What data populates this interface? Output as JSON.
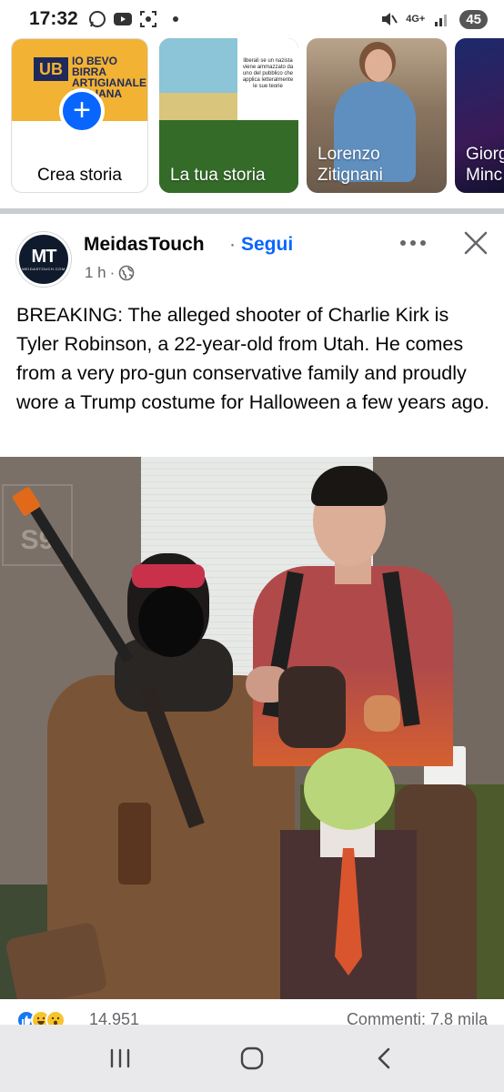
{
  "status_bar": {
    "time": "17:32",
    "network": "4G+",
    "battery": "45"
  },
  "stories": {
    "create_label": "Crea storia",
    "create_logo_main": "UB",
    "create_logo_text": "IO BEVO BIRRA ARTIGIANALE ITALIANA",
    "mine_label": "La tua storia",
    "mine_note_text": "liberali se un nazista viene ammazzato da uno del pubblico che applica letteralmente le sue teorie",
    "lorenzo_label": "Lorenzo Zitignani",
    "giorg_label": "Giorg Minc"
  },
  "post": {
    "author": "MeidasTouch",
    "follow_separator": "·",
    "follow_label": "Segui",
    "time": "1 h",
    "meta_separator": "·",
    "avatar_text": "MT",
    "avatar_subtext": "MEIDASTOUCH.COM",
    "text": "BREAKING: The alleged shooter of Charlie Kirk is Tyler Robinson, a 22-year-old from Utah. He comes from a very pro-gun conservative family and proudly wore a Trump costume for Halloween a few years ago.",
    "photo_number": "S9",
    "reaction_count": "14.951",
    "comments": "Commenti: 7,8 mila"
  },
  "colors": {
    "accent": "#0866ff",
    "secondary_text": "#65676b",
    "divider": "#c9ccd1"
  },
  "icons": {
    "more": "more-horizontal-icon",
    "close": "close-icon",
    "globe": "globe-icon",
    "nav_recent": "recent-apps-icon",
    "nav_home": "home-icon",
    "nav_back": "back-icon"
  }
}
